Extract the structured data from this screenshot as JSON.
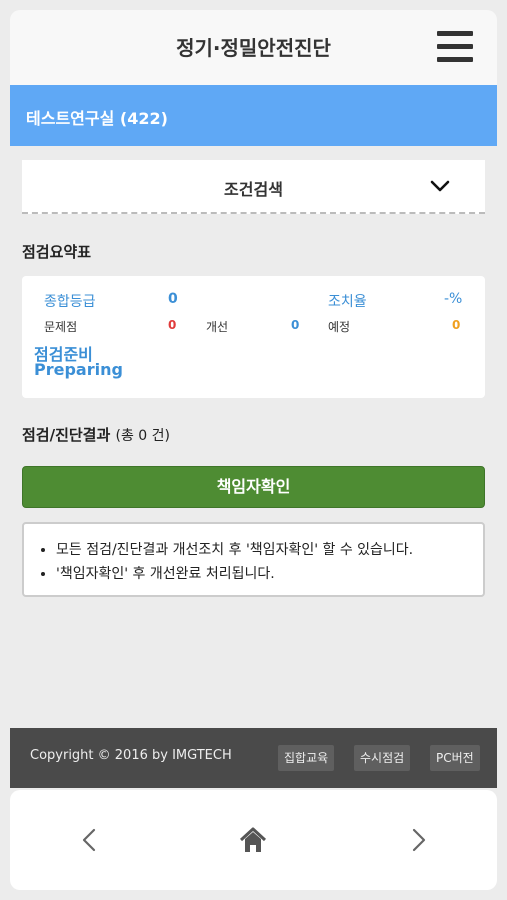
{
  "header": {
    "title": "정기·정밀안전진단",
    "menu_icon": "hamburger-icon"
  },
  "lab": {
    "name": "테스트연구실 (422)"
  },
  "search": {
    "label": "조건검색",
    "toggle_icon": "chevron-down-icon"
  },
  "summary": {
    "title": "점검요약표",
    "overall_grade_label": "종합등급",
    "overall_grade_value": "0",
    "action_rate_label": "조치율",
    "action_rate_value": "-%",
    "issues_label": "문제점",
    "issues_value": "0",
    "improve_label": "개선",
    "improve_value": "0",
    "planned_label": "예정",
    "planned_value": "0",
    "status_ko": "점검준비",
    "status_en": "Preparing"
  },
  "results": {
    "title": "점검/진단결과",
    "count_text": "(총 0 건)"
  },
  "confirm_button": {
    "label": "책임자확인"
  },
  "notice": {
    "items": [
      "모든 점검/진단결과 개선조치 후 '책임자확인' 할 수 있습니다.",
      "'책임자확인' 후 개선완료 처리됩니다."
    ]
  },
  "footer": {
    "copyright": "Copyright © 2016 by IMGTECH",
    "links": [
      "집합교육",
      "수시점검",
      "PC버전"
    ]
  },
  "navbar": {
    "back_icon": "chevron-left-icon",
    "home_icon": "home-icon",
    "forward_icon": "chevron-right-icon"
  },
  "colors": {
    "accent_blue": "#5fa8f5",
    "confirm_green": "#4e8c33",
    "footer_gray": "#4a4a4a",
    "text_blue": "#3b8fd6",
    "alert_red": "#e03b3b",
    "planned_orange": "#f0a020"
  }
}
